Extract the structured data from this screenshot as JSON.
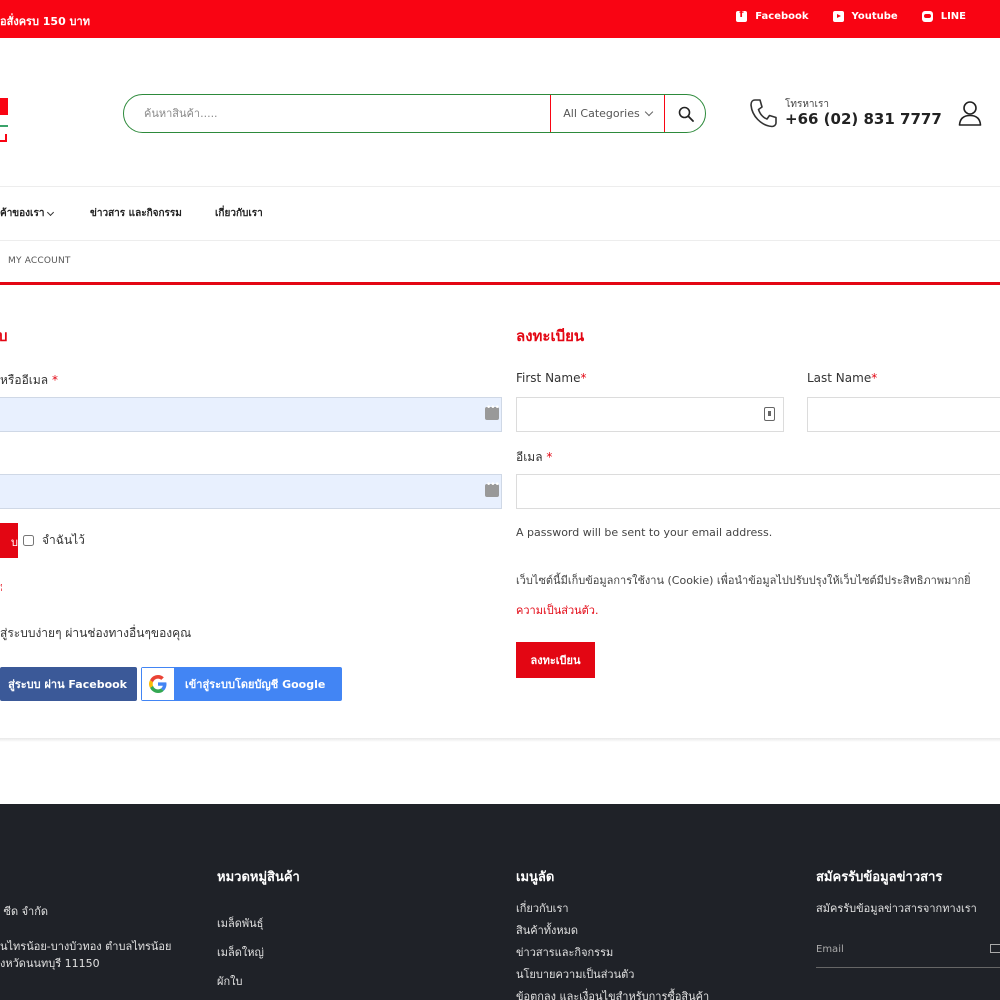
{
  "topbar": {
    "promo": "ื่อสั่งครบ 150 บาท",
    "social": [
      {
        "icon": "facebook-icon",
        "label": "Facebook"
      },
      {
        "icon": "youtube-icon",
        "label": "Youtube"
      },
      {
        "icon": "line-icon",
        "label": "LINE"
      }
    ]
  },
  "header": {
    "search_placeholder": "ค้นหาสินค้า.....",
    "category_label": "All Categories",
    "contact_label": "โทรหาเรา",
    "contact_phone": "+66 (02) 831 7777"
  },
  "nav": {
    "items": [
      "ค้าของเรา",
      "ข่าวสาร และกิจกรรม",
      "เกี่ยวกับเรา"
    ]
  },
  "breadcrumb": "MY ACCOUNT",
  "login": {
    "title": "บ",
    "username_label": "หรืออีเมล",
    "required_mark": "*",
    "button_label": "บ",
    "remember_label": "จำฉันไว้",
    "lost_password": "ม",
    "social_text": "สู่ระบบง่ายๆ ผ่านช่องทางอื่นๆของคุณ",
    "facebook_button": "สู่ระบบ ผ่าน Facebook",
    "google_button": "เข้าสู่ระบบโดยบัญชี Google"
  },
  "register": {
    "title": "ลงทะเบียน",
    "first_name_label": "First Name",
    "last_name_label": "Last Name",
    "email_label": "อีเมล",
    "required_mark": "*",
    "password_note": "A password will be sent to your email address.",
    "cookie_text": "เว็บไซต์นี้มีเก็บข้อมูลการใช้งาน (Cookie) เพื่อนำข้อมูลไปปรับปรุงให้เว็บไซต์มีประสิทธิภาพมากยิ่",
    "privacy_link": "ความเป็นส่วนตัว.",
    "button_label": "ลงทะเบียน"
  },
  "footer": {
    "company": {
      "lines": [
        "ี ซีด จำกัด",
        "นไทรน้อย-บางบัวทอง ตำบลไทรน้อย",
        "งหวัดนนทบุรี 11150"
      ]
    },
    "categories": {
      "title": "หมวดหมู่สินค้า",
      "items": [
        "เมล็ดพันธุ์",
        "เมล็ดใหญ่",
        "ผักใบ"
      ]
    },
    "menu": {
      "title": "เมนูลัด",
      "items": [
        "เกี่ยวกับเรา",
        "สินค้าทั้งหมด",
        "ข่าวสารและกิจกรรม",
        "นโยบายความเป็นส่วนตัว",
        "ข้อตกลง และเงื่อนไขสำหรับการซื้อสินค้า"
      ]
    },
    "newsletter": {
      "title": "สมัครรับข้อมูลข่าวสาร",
      "text": "สมัครรับข้อมูลข่าวสารจากทางเรา",
      "email_placeholder": "Email"
    }
  },
  "colors": {
    "brand_red": "#f90413",
    "accent_red": "#e30613",
    "search_border": "#2d8a3b",
    "facebook_blue": "#3b5998",
    "google_blue": "#4285f4",
    "footer_bg": "#1f2228"
  }
}
